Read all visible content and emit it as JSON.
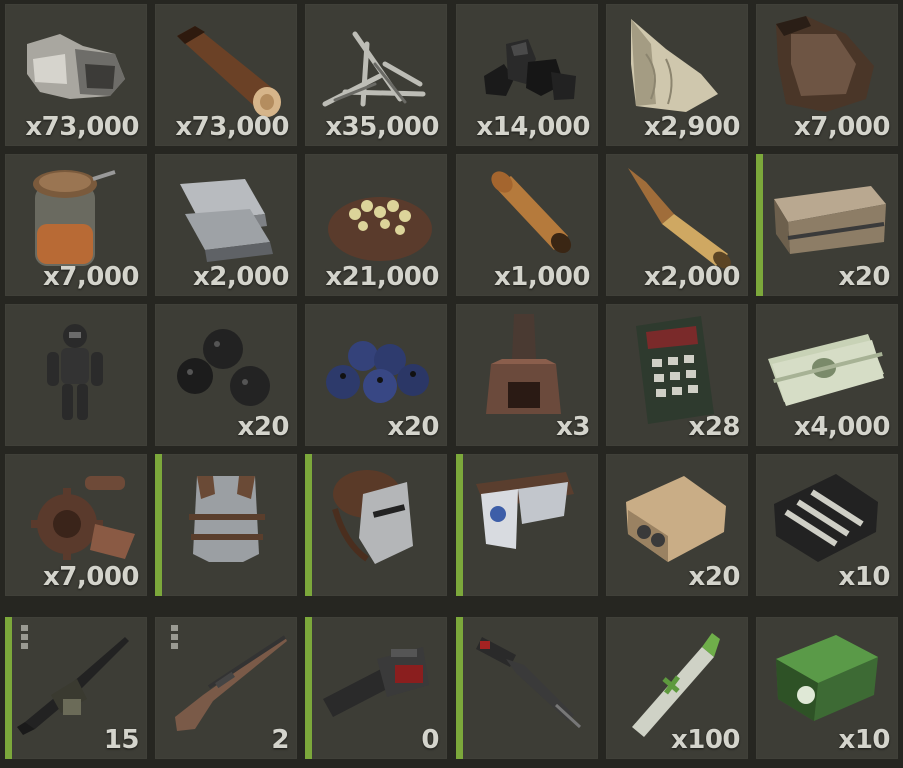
{
  "inventory": {
    "rows": [
      [
        {
          "name": "stone-icon",
          "qty": "x73,000",
          "equipped": false
        },
        {
          "name": "wood-log-icon",
          "qty": "x73,000",
          "equipped": false
        },
        {
          "name": "metal-fragments-icon",
          "qty": "x35,000",
          "equipped": false
        },
        {
          "name": "charcoal-icon",
          "qty": "x14,000",
          "equipped": false
        },
        {
          "name": "cloth-icon",
          "qty": "x2,900",
          "equipped": false
        },
        {
          "name": "leather-icon",
          "qty": "x7,000",
          "equipped": false
        }
      ],
      [
        {
          "name": "gunpowder-jar-icon",
          "qty": "x7,000",
          "equipped": false
        },
        {
          "name": "metal-ingots-icon",
          "qty": "x2,000",
          "equipped": false
        },
        {
          "name": "sulfur-ore-icon",
          "qty": "x21,000",
          "equipped": false
        },
        {
          "name": "pistol-bullet-icon",
          "qty": "x1,000",
          "equipped": false
        },
        {
          "name": "rifle-bullet-icon",
          "qty": "x2,000",
          "equipped": false
        },
        {
          "name": "wooden-crate-icon",
          "qty": "x20",
          "equipped": true
        }
      ],
      [
        {
          "name": "hazmat-suit-icon",
          "qty": "",
          "equipped": false
        },
        {
          "name": "blackberries-icon",
          "qty": "x20",
          "equipped": false
        },
        {
          "name": "blueberries-icon",
          "qty": "x20",
          "equipped": false
        },
        {
          "name": "furnace-tower-icon",
          "qty": "x3",
          "equipped": false
        },
        {
          "name": "keypad-calculator-icon",
          "qty": "x28",
          "equipped": false
        },
        {
          "name": "cash-bundle-icon",
          "qty": "x4,000",
          "equipped": false
        }
      ],
      [
        {
          "name": "scrap-gears-icon",
          "qty": "x7,000",
          "equipped": false
        },
        {
          "name": "metal-chestplate-icon",
          "qty": "",
          "equipped": true
        },
        {
          "name": "metal-facemask-icon",
          "qty": "",
          "equipped": true
        },
        {
          "name": "roadsign-kilt-icon",
          "qty": "",
          "equipped": true
        },
        {
          "name": "explosive-charge-icon",
          "qty": "x20",
          "equipped": false
        },
        {
          "name": "tech-trash-icon",
          "qty": "x10",
          "equipped": false
        }
      ],
      [
        {
          "name": "m249-rifle-icon",
          "qty": "15",
          "equipped": true,
          "cond": 3
        },
        {
          "name": "bolt-rifle-icon",
          "qty": "2",
          "equipped": false,
          "cond": 3
        },
        {
          "name": "chainsaw-icon",
          "qty": "0",
          "equipped": true
        },
        {
          "name": "jackhammer-icon",
          "qty": "",
          "equipped": true
        },
        {
          "name": "syringe-icon",
          "qty": "x100",
          "equipped": false
        },
        {
          "name": "medkit-icon",
          "qty": "x10",
          "equipped": false
        }
      ]
    ]
  }
}
